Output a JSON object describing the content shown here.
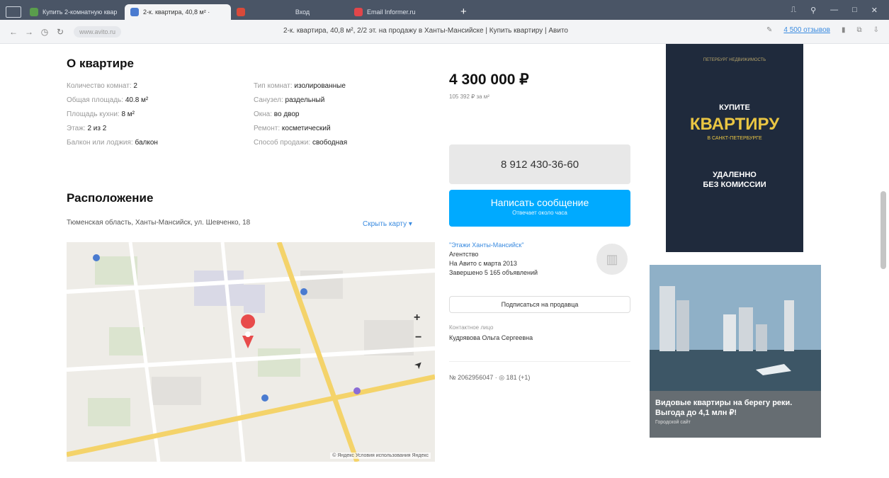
{
  "browser": {
    "tabs": [
      {
        "label": "Купить 2-комнатную квар",
        "color": "#5a9e4c"
      },
      {
        "label": "2-к. квартира, 40,8 м² ·",
        "color": "#4a7bd0"
      },
      {
        "label": "",
        "color": "#d94a3a"
      },
      {
        "label": "Вход",
        "color": "#4a5566"
      },
      {
        "label": "Email Informer.ru",
        "color": "#e2464a"
      }
    ],
    "new_tab": "+",
    "window_controls": [
      "⎍",
      "⚲",
      "—",
      "□",
      "✕"
    ],
    "url": "www.avito.ru",
    "page_title": "2-к. квартира, 40,8 м², 2/2 эт. на продажу в Ханты-Мансийске | Купить квартиру | Авито",
    "addr_right": "4 500 отзывов"
  },
  "apartment": {
    "title": "О квартире",
    "params_left": [
      {
        "k": "Количество комнат:",
        "v": "2"
      },
      {
        "k": "Общая площадь:",
        "v": "40.8 м²"
      },
      {
        "k": "Площадь кухни:",
        "v": "8 м²"
      },
      {
        "k": "Этаж:",
        "v": "2 из 2"
      },
      {
        "k": "Балкон или лоджия:",
        "v": "балкон"
      }
    ],
    "params_right": [
      {
        "k": "Тип комнат:",
        "v": "изолированные"
      },
      {
        "k": "Санузел:",
        "v": "раздельный"
      },
      {
        "k": "Окна:",
        "v": "во двор"
      },
      {
        "k": "Ремонт:",
        "v": "косметический"
      },
      {
        "k": "Способ продажи:",
        "v": "свободная"
      }
    ]
  },
  "location": {
    "title": "Расположение",
    "address": "Тюменская область, Ханты-Мансийск, ул. Шевченко, 18",
    "show_map": "Скрыть карту ▾",
    "map_plus": "+",
    "map_minus": "−",
    "map_arrow": "➤",
    "map_footer": "© Яндекс  Условия использования  Яндекс"
  },
  "sidebar": {
    "price": "4 300 000 ₽",
    "price_per_meter": "105 392 ₽ за м²",
    "phone": "8 912 430-36-60",
    "message_title": "Написать сообщение",
    "message_sub": "Отвечает около часа",
    "seller_name": "\"Этажи Ханты-Мансийск\"",
    "seller_type": "Агентство",
    "seller_since": "На Авито с марта 2013",
    "seller_count": "Завершено 5 165 объявлений",
    "subscribe": "Подписаться на продавца",
    "contact_label": "Контактное лицо",
    "contact_name": "Кудрявова Ольга Сергеевна",
    "listing": "№ 2062956047  ·  ◎ 181 (+1)"
  },
  "ads": {
    "ad1": {
      "top": "ПЕТЕРБУРГ НЕДВИЖИМОСТЬ",
      "l1": "КУПИТЕ",
      "l2": "КВАРТИРУ",
      "l3": "В САНКТ-ПЕТЕРБУРГЕ",
      "l4": "УДАЛЕННО",
      "l5": "БЕЗ КОМИССИИ"
    },
    "ad2": {
      "title": "Видовые квартиры на берегу реки. Выгода до 4,1 млн ₽!",
      "sub": "Городской сайт"
    }
  }
}
